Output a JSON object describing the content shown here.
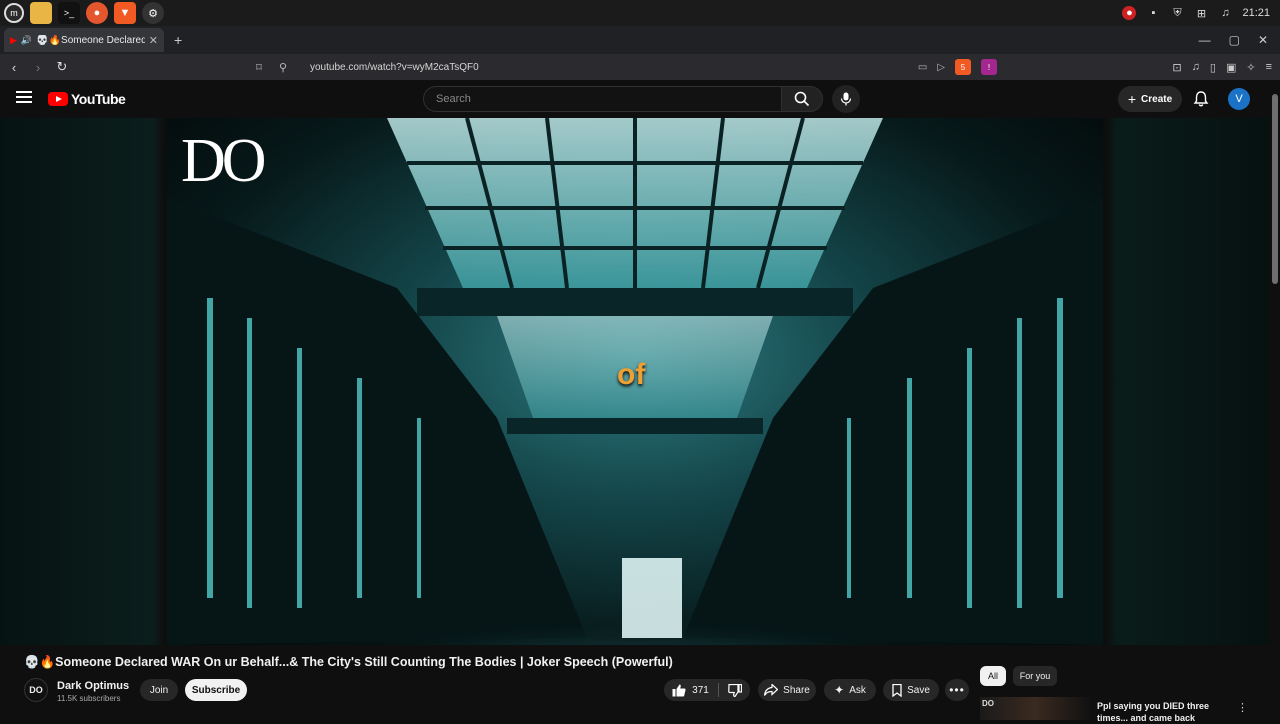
{
  "taskbar": {
    "clock": "21:21"
  },
  "browser": {
    "tab_title": "💀🔥Someone Declared W",
    "url": "youtube.com/watch?v=wyM2caTsQF0",
    "brave_badge": "5",
    "alert_badge": "!"
  },
  "header": {
    "logo_text": "YouTube",
    "search_placeholder": "Search",
    "create_label": "Create",
    "avatar_letter": "V"
  },
  "video": {
    "logo_text": "DO",
    "caption": "of"
  },
  "meta": {
    "title": "💀🔥Someone Declared WAR On ur Behalf...& The City's Still Counting The Bodies | Joker Speech (Powerful)",
    "channel_avatar": "DO",
    "channel_name": "Dark Optimus",
    "subscribers": "11.5K subscribers",
    "join_label": "Join",
    "subscribe_label": "Subscribe",
    "like_count": "371",
    "share_label": "Share",
    "ask_label": "Ask",
    "save_label": "Save"
  },
  "sidebar": {
    "filters": [
      "All",
      "For you"
    ],
    "rec_thumb_label": "DO",
    "rec_title": "Ppl saying you DIED three times... and came back"
  },
  "colors": {
    "yt_red": "#ff0000",
    "avatar_blue": "#1a73c7",
    "caption_orange": "#f0a030"
  }
}
